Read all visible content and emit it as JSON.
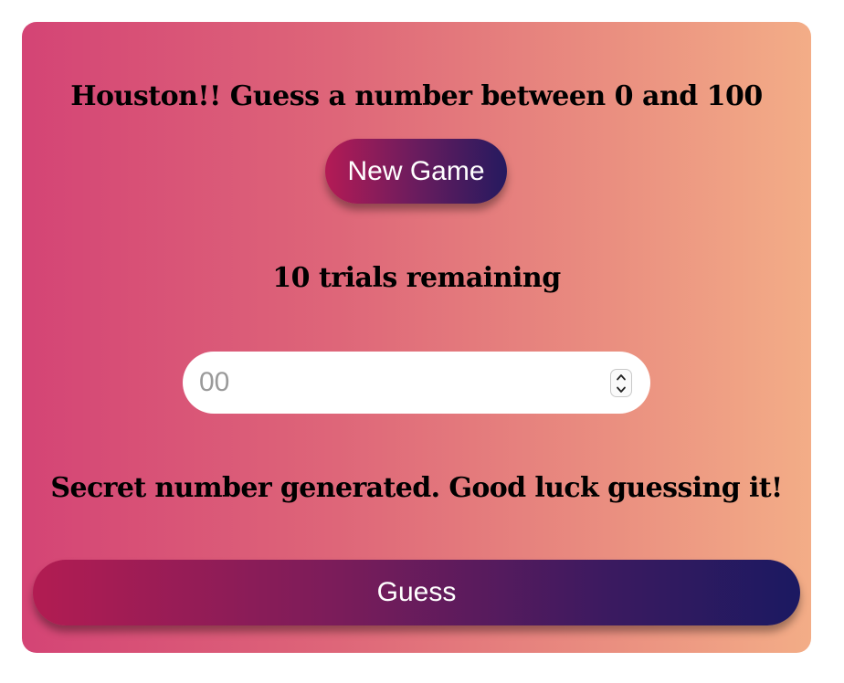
{
  "game": {
    "title": "Houston!! Guess a number between 0 and 100",
    "new_game_label": "New Game",
    "trials_text": "10 trials remaining",
    "guess_input": {
      "placeholder": "00",
      "value": ""
    },
    "message": "Secret number generated. Good luck guessing it!",
    "guess_label": "Guess"
  },
  "icons": {
    "spinner_up": "chevron-up-icon",
    "spinner_down": "chevron-down-icon"
  },
  "colors": {
    "card_gradient_start": "#d44475",
    "card_gradient_end": "#f3ad87",
    "button_gradient_start": "#b21c52",
    "button_gradient_end": "#1b1961"
  }
}
